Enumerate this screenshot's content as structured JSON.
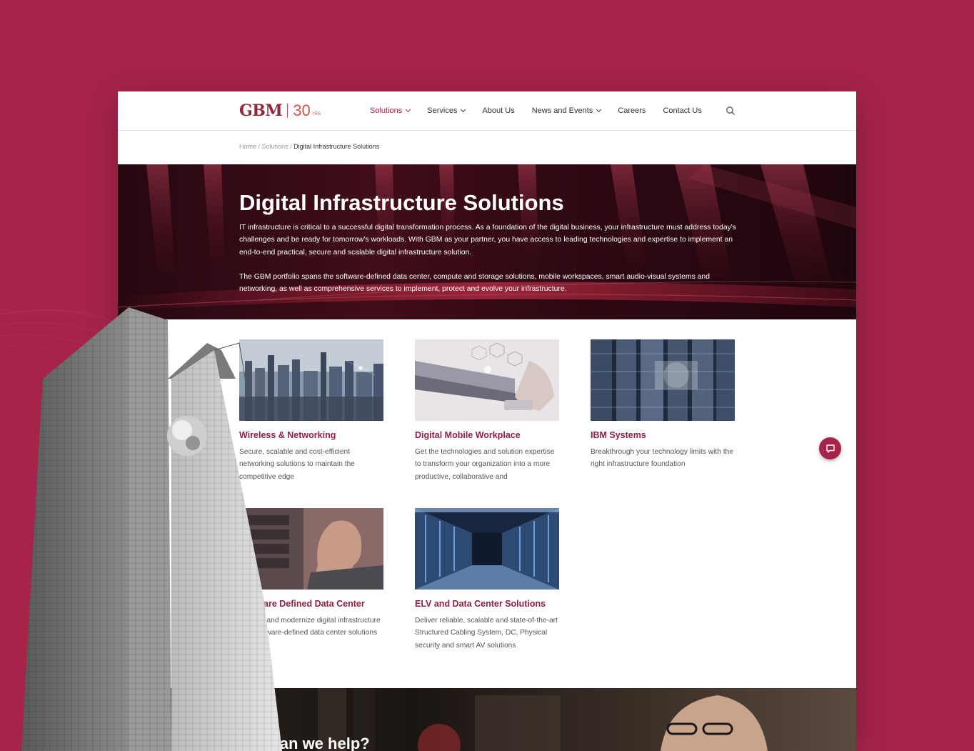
{
  "logo": {
    "brand": "GBM",
    "anniversary": "30",
    "anniversary_suffix": "YRS"
  },
  "nav": {
    "items": [
      {
        "label": "Solutions",
        "has_dropdown": true,
        "active": true
      },
      {
        "label": "Services",
        "has_dropdown": true,
        "active": false
      },
      {
        "label": "About Us",
        "has_dropdown": false,
        "active": false
      },
      {
        "label": "News and Events",
        "has_dropdown": true,
        "active": false
      },
      {
        "label": "Careers",
        "has_dropdown": false,
        "active": false
      },
      {
        "label": "Contact Us",
        "has_dropdown": false,
        "active": false
      }
    ],
    "search_icon": "search-icon"
  },
  "breadcrumb": {
    "home": "Home",
    "sep": "/",
    "section": "Solutions",
    "current": "Digital Infrastructure Solutions"
  },
  "hero": {
    "title": "Digital Infrastructure Solutions",
    "paragraph1": "IT infrastructure is critical to a successful digital transformation process. As a foundation of the digital business, your infrastructure must address today's challenges and be ready for tomorrow's workloads. With GBM as your partner, you have access to leading technologies and expertise to implement an end-to-end practical, secure and scalable digital infrastructure solution.",
    "paragraph2": "The GBM portfolio spans the software-defined data center, compute and storage solutions, mobile workspaces, smart audio-visual systems and networking, as well as comprehensive services to implement, protect and evolve your infrastructure."
  },
  "cards": [
    {
      "title": "Wireless & Networking",
      "desc": "Secure, scalable and cost-efficient networking solutions to maintain the competitive edge"
    },
    {
      "title": "Digital Mobile Workplace",
      "desc": "Get the technologies and solution expertise to transform your organization into a more productive, collaborative and"
    },
    {
      "title": "IBM Systems",
      "desc": "Breakthrough your technology limits with the right infrastructure foundation"
    },
    {
      "title": "Software Defined Data Center",
      "desc": "Simplify and modernize digital infrastructure with software-defined data center solutions"
    },
    {
      "title": "ELV and Data Center Solutions",
      "desc": "Deliver reliable, scalable and state-of-the-art Structured Cabling System, DC, Physical security and smart AV solutions"
    }
  ],
  "bottom": {
    "title": "How can we help?"
  },
  "chat": {
    "icon": "chat-icon"
  },
  "colors": {
    "brand": "#a6244a",
    "title_red": "#8f2040",
    "background": "#a6244a"
  }
}
